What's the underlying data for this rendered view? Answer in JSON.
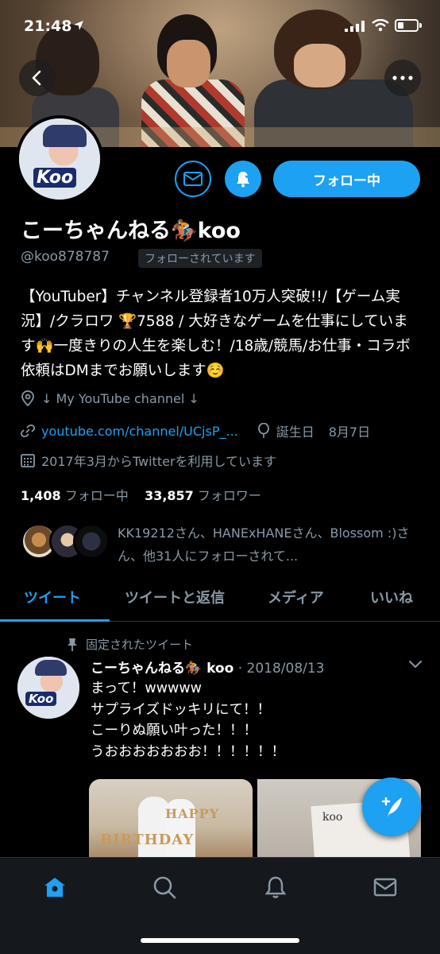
{
  "status_bar": {
    "time": "21:48"
  },
  "profile": {
    "name": "こーちゃんねる🏇koo",
    "handle": "@koo878787",
    "follows_you": "フォローされています",
    "avatar_text": "Koo",
    "follow_button": "フォロー中",
    "bio": "【YouTuber】チャンネル登録者10万人突破!!/【ゲーム実況】/クラロワ 🏆7588 / 大好きなゲームを仕事にしています🙌一度きりの人生を楽しむ！/18歳/競馬/お仕事・コラボ依頼はDMまでお願いします☺️",
    "location": "↓ My YouTube channel ↓",
    "url": "youtube.com/channel/UCjsP_...",
    "birthday_label": "誕生日",
    "birthday": "8月7日",
    "joined": "2017年3月からTwitterを利用しています",
    "following_count": "1,408",
    "following_label": "フォロー中",
    "followers_count": "33,857",
    "followers_label": "フォロワー",
    "followed_by": "KK19212さん、HANExHANEさん、Blossom :)さん、他31人にフォローされて..."
  },
  "tabs": [
    {
      "label": "ツイート",
      "active": true
    },
    {
      "label": "ツイートと返信",
      "active": false
    },
    {
      "label": "メディア",
      "active": false
    },
    {
      "label": "いいね",
      "active": false
    }
  ],
  "tweet": {
    "pinned_label": "固定されたツイート",
    "author": "こーちゃんねる🏇 koo",
    "date": "· 2018/08/13",
    "text": "まって！wwwww\nサプライズドッキリにて！！\nこーりぬ願い叶った！！！\nうおおおおおおお！！！！！！",
    "media_1_text": "HAPPY",
    "media_1_text_2": "BIRTHDAY",
    "media_2_text": "koo"
  },
  "colors": {
    "accent": "#1da1f2",
    "background": "#000000",
    "muted": "#8899a6"
  },
  "icons": [
    "back-icon",
    "more-icon",
    "mail-icon",
    "bell-icon",
    "location-icon",
    "link-icon",
    "balloon-icon",
    "calendar-icon",
    "pin-icon",
    "chevron-down-icon",
    "compose-icon",
    "home-icon",
    "search-icon",
    "notifications-icon",
    "messages-icon"
  ]
}
